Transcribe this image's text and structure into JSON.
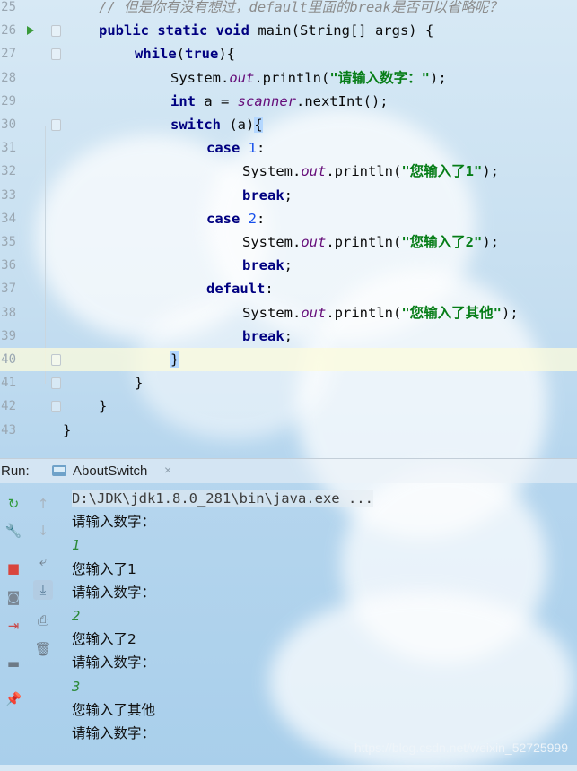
{
  "editor": {
    "current_line": 40,
    "lines": [
      {
        "n": "25",
        "tokens": [
          [
            "cmt",
            "// 但是你有没有想过，default里面的break是否可以省略呢？"
          ]
        ]
      },
      {
        "n": "26",
        "tokens": [
          [
            "kw",
            "public static void "
          ],
          [
            "plain",
            "main(String[] args) {"
          ]
        ]
      },
      {
        "n": "27",
        "tokens": [
          [
            "kw",
            "while"
          ],
          [
            "plain",
            "("
          ],
          [
            "kw",
            "true"
          ],
          [
            "plain",
            "){"
          ]
        ]
      },
      {
        "n": "28",
        "tokens": [
          [
            "plain",
            "System."
          ],
          [
            "fld",
            "out"
          ],
          [
            "plain",
            ".println("
          ],
          [
            "str",
            "\"请输入数字：\""
          ],
          [
            "plain",
            ");"
          ]
        ]
      },
      {
        "n": "29",
        "tokens": [
          [
            "kw",
            "int "
          ],
          [
            "plain",
            "a = "
          ],
          [
            "fld",
            "scanner"
          ],
          [
            "plain",
            ".nextInt();"
          ]
        ]
      },
      {
        "n": "30",
        "tokens": [
          [
            "kw",
            "switch "
          ],
          [
            "plain",
            "(a)"
          ],
          [
            "brace",
            "{"
          ]
        ]
      },
      {
        "n": "31",
        "tokens": [
          [
            "kw",
            "case "
          ],
          [
            "num",
            "1"
          ],
          [
            "plain",
            ":"
          ]
        ]
      },
      {
        "n": "32",
        "tokens": [
          [
            "plain",
            "System."
          ],
          [
            "fld",
            "out"
          ],
          [
            "plain",
            ".println("
          ],
          [
            "str",
            "\"您输入了1\""
          ],
          [
            "plain",
            ");"
          ]
        ]
      },
      {
        "n": "33",
        "tokens": [
          [
            "kw",
            "break"
          ],
          [
            "plain",
            ";"
          ]
        ]
      },
      {
        "n": "34",
        "tokens": [
          [
            "kw",
            "case "
          ],
          [
            "num",
            "2"
          ],
          [
            "plain",
            ":"
          ]
        ]
      },
      {
        "n": "35",
        "tokens": [
          [
            "plain",
            "System."
          ],
          [
            "fld",
            "out"
          ],
          [
            "plain",
            ".println("
          ],
          [
            "str",
            "\"您输入了2\""
          ],
          [
            "plain",
            ");"
          ]
        ]
      },
      {
        "n": "36",
        "tokens": [
          [
            "kw",
            "break"
          ],
          [
            "plain",
            ";"
          ]
        ]
      },
      {
        "n": "37",
        "tokens": [
          [
            "kw",
            "default"
          ],
          [
            "plain",
            ":"
          ]
        ]
      },
      {
        "n": "38",
        "tokens": [
          [
            "plain",
            "System."
          ],
          [
            "fld",
            "out"
          ],
          [
            "plain",
            ".println("
          ],
          [
            "str",
            "\"您输入了其他\""
          ],
          [
            "plain",
            ");"
          ]
        ]
      },
      {
        "n": "39",
        "tokens": [
          [
            "kw",
            "break"
          ],
          [
            "plain",
            ";"
          ]
        ]
      },
      {
        "n": "40",
        "tokens": [
          [
            "brace",
            "}"
          ]
        ]
      },
      {
        "n": "41",
        "tokens": [
          [
            "plain",
            "}"
          ]
        ]
      },
      {
        "n": "42",
        "tokens": [
          [
            "plain",
            "}"
          ]
        ]
      },
      {
        "n": "43",
        "tokens": [
          [
            "plain",
            "}"
          ]
        ]
      }
    ]
  },
  "run_panel": {
    "label": "Run:",
    "tab_label": "AboutSwitch",
    "tab_close": "×",
    "left_tools": [
      {
        "name": "rerun-icon",
        "glyph": "↻",
        "color": "#2f9a3a"
      },
      {
        "name": "wrench-icon",
        "glyph": "🔧",
        "color": "#7a8794"
      },
      {
        "name": "stop-icon",
        "glyph": "■",
        "color": "#d9453d"
      },
      {
        "name": "camera-icon",
        "glyph": "◙",
        "color": "#7a8794"
      },
      {
        "name": "exit-icon",
        "glyph": "⇥",
        "color": "#c84a4a"
      },
      {
        "name": "layout-icon",
        "glyph": "▬",
        "color": "#6d7a86"
      },
      {
        "name": "pin-icon",
        "glyph": "📌",
        "color": "#7a8794"
      }
    ],
    "right_tools": [
      {
        "name": "up-arrow-icon",
        "glyph": "↑",
        "color": "#a8b4bf"
      },
      {
        "name": "down-arrow-icon",
        "glyph": "↓",
        "color": "#a8b4bf"
      },
      {
        "name": "soft-wrap-icon",
        "glyph": "⤶",
        "color": "#6d7a86"
      },
      {
        "name": "scroll-to-end-icon",
        "glyph": "⤓",
        "color": "#4a6f8c"
      },
      {
        "name": "print-icon",
        "glyph": "⎙",
        "color": "#6d7a86"
      },
      {
        "name": "trash-icon",
        "glyph": "🗑",
        "color": "#6d7a86"
      }
    ],
    "console": [
      {
        "type": "cmd",
        "text": "D:\\JDK\\jdk1.8.0_281\\bin\\java.exe ..."
      },
      {
        "type": "out",
        "text": "请输入数字："
      },
      {
        "type": "in",
        "text": "1"
      },
      {
        "type": "out",
        "text": "您输入了1"
      },
      {
        "type": "out",
        "text": "请输入数字："
      },
      {
        "type": "in",
        "text": "2"
      },
      {
        "type": "out",
        "text": "您输入了2"
      },
      {
        "type": "out",
        "text": "请输入数字："
      },
      {
        "type": "in",
        "text": "3"
      },
      {
        "type": "out",
        "text": "您输入了其他"
      },
      {
        "type": "out",
        "text": "请输入数字："
      }
    ]
  },
  "watermark": "https://blog.csdn.net/weixin_52725999"
}
